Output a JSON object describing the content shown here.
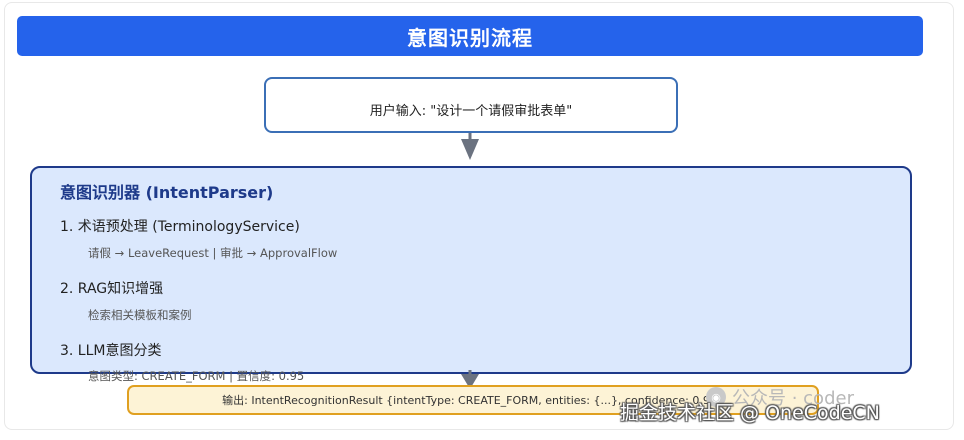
{
  "header": {
    "title": "意图识别流程"
  },
  "input_node": {
    "text": "用户输入: \"设计一个请假审批表单\""
  },
  "parser": {
    "title": "意图识别器 (IntentParser)",
    "steps": [
      {
        "label": "1. 术语预处理 (TerminologyService)",
        "detail": "请假 → LeaveRequest | 审批 → ApprovalFlow"
      },
      {
        "label": "2. RAG知识增强",
        "detail": "检索相关模板和案例"
      },
      {
        "label": "3. LLM意图分类",
        "detail": "意图类型: CREATE_FORM | 置信度: 0.95"
      }
    ]
  },
  "output_node": {
    "text": "输出: IntentRecognitionResult {intentType: CREATE_FORM, entities: {...}, confidence: 0.95}"
  },
  "watermark": {
    "account": "公众号 · coder",
    "site": "掘金技术社区 @ OneCodeCN"
  },
  "colors": {
    "title_bar": "#2563eb",
    "input_border": "#3b6fb6",
    "parser_border": "#1e3a8a",
    "parser_fill": "#dbe8fd",
    "output_border": "#e0a020",
    "output_fill": "#fdf3d6",
    "arrow": "#6b7280"
  }
}
